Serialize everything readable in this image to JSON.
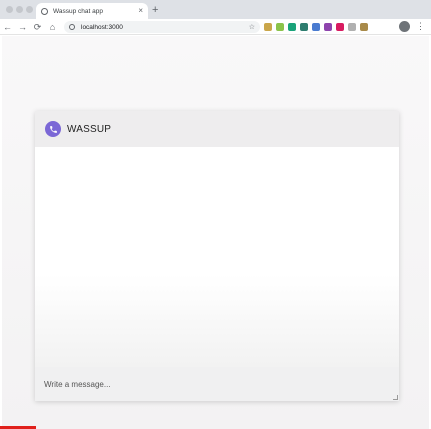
{
  "browser": {
    "tab_title": "Wassup chat app",
    "tab_close": "×",
    "new_tab": "+",
    "address": "localhost:3000",
    "star": "☆",
    "menu": "⋮",
    "nav": {
      "back": "←",
      "forward": "→",
      "reload": "⟳",
      "home": "⌂"
    },
    "extensions": [
      {
        "name": "pen-extension-icon",
        "color": "#caa64a"
      },
      {
        "name": "circle-extension-icon",
        "color": "#8bc34a"
      },
      {
        "name": "green-extension-icon",
        "color": "#1aa37a"
      },
      {
        "name": "funnel-extension-icon",
        "color": "#2e7d6f"
      },
      {
        "name": "translate-extension-icon",
        "color": "#4a7bd0"
      },
      {
        "name": "vue-extension-icon",
        "color": "#8e44ad"
      },
      {
        "name": "heart-extension-icon",
        "color": "#d81b60"
      },
      {
        "name": "grid-extension-icon",
        "color": "#b0b0b0"
      },
      {
        "name": "cookie-extension-icon",
        "color": "#a88a4a"
      }
    ]
  },
  "chat": {
    "app_name": "WASSUP",
    "logo_icon": "phone-icon",
    "accent": "#7b67d6",
    "composer_placeholder": "Write a message..."
  }
}
